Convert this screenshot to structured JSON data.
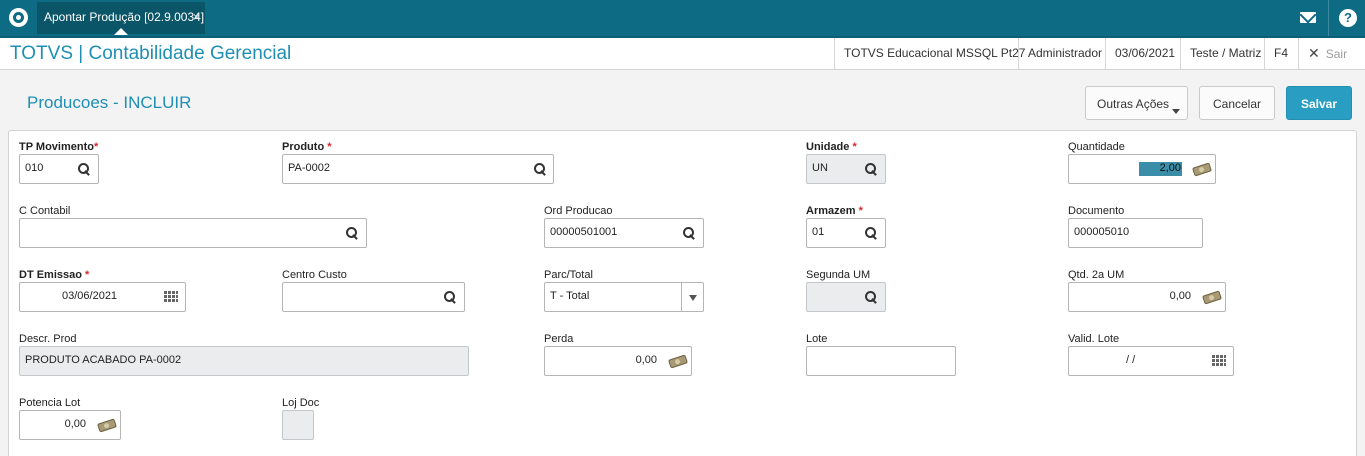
{
  "topbar": {
    "tab_label": "Apontar Produção [02.9.0034]",
    "tab_close": "×",
    "help_label": "?"
  },
  "header": {
    "app_title": "TOTVS | Contabilidade Gerencial",
    "environment": "TOTVS Educacional MSSQL Pt27",
    "user": "Administrador",
    "date": "03/06/2021",
    "branch": "Teste / Matriz",
    "shortcut": "F4",
    "exit_label": "Sair"
  },
  "page": {
    "title": "Producoes - INCLUIR",
    "more_actions_label": "Outras Ações",
    "cancel_label": "Cancelar",
    "save_label": "Salvar"
  },
  "form": {
    "tp_movimento": {
      "label": "TP Movimento",
      "required": "*",
      "value": "010"
    },
    "produto": {
      "label": "Produto",
      "required": "*",
      "value": "PA-0002"
    },
    "unidade": {
      "label": "Unidade",
      "required": "*",
      "value": "UN"
    },
    "quantidade": {
      "label": "Quantidade",
      "value": "2,00"
    },
    "c_contabil": {
      "label": "C Contabil",
      "value": ""
    },
    "ord_producao": {
      "label": "Ord Producao",
      "value": "00000501001"
    },
    "armazem": {
      "label": "Armazem",
      "required": "*",
      "value": "01"
    },
    "documento": {
      "label": "Documento",
      "value": "000005010"
    },
    "dt_emissao": {
      "label": "DT Emissao",
      "required": "*",
      "value": "03/06/2021"
    },
    "centro_custo": {
      "label": "Centro Custo",
      "value": ""
    },
    "parc_total": {
      "label": "Parc/Total",
      "value": "T - Total"
    },
    "segunda_um": {
      "label": "Segunda UM",
      "value": ""
    },
    "qtd_2a_um": {
      "label": "Qtd. 2a UM",
      "value": "0,00"
    },
    "descr_prod": {
      "label": "Descr. Prod",
      "value": "PRODUTO ACABADO PA-0002"
    },
    "perda": {
      "label": "Perda",
      "value": "0,00"
    },
    "lote": {
      "label": "Lote",
      "value": ""
    },
    "valid_lote": {
      "label": "Valid. Lote",
      "value": "/  /"
    },
    "potencia_lot": {
      "label": "Potencia Lot",
      "value": "0,00"
    },
    "loj_doc": {
      "label": "Loj Doc",
      "value": ""
    }
  },
  "colors": {
    "topbar": "#0d6b84",
    "accent": "#1f8fb4",
    "save_button": "#2a9ec2",
    "required": "#d9272e"
  },
  "icons": [
    "totvs-logo-icon",
    "mail-icon",
    "help-icon",
    "close-icon",
    "search-icon",
    "money-icon",
    "calendar-icon",
    "chevron-down-icon"
  ]
}
